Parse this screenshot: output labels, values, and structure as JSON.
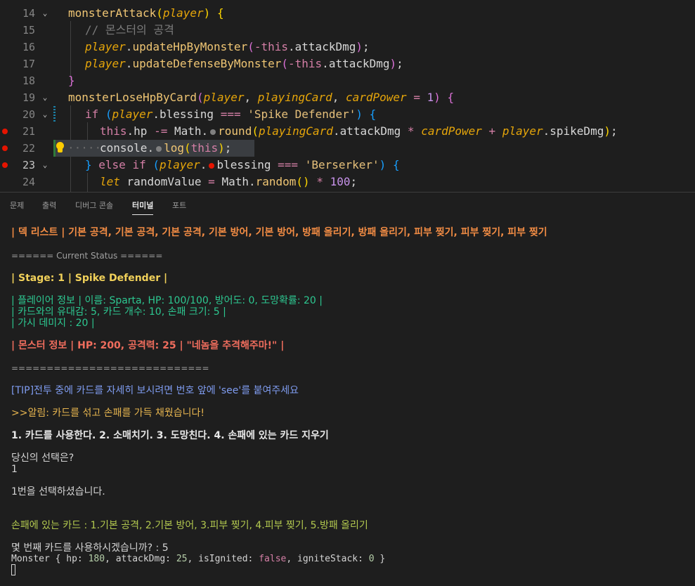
{
  "editor": {
    "lines": [
      {
        "num": "14",
        "tokens": [
          [
            "monsterAttack",
            "c-def"
          ],
          [
            "(",
            "b1c"
          ],
          [
            "player",
            "c-param"
          ],
          ")",
          "b1c"
        ],
        "fold": "⌄",
        "indent": 0
      },
      {
        "num": "15",
        "tokens": [
          [
            "// 몬스터의 공격",
            "c-cmt"
          ]
        ],
        "indent": 1
      },
      {
        "num": "16",
        "tokens": [
          [
            "player",
            "c-param"
          ],
          [
            ".",
            "op"
          ],
          [
            "updateHpByMonster",
            "c-def"
          ],
          [
            "(",
            "b2c"
          ],
          [
            "-",
            "c-key"
          ],
          [
            "this",
            "c-this"
          ],
          [
            ".attackDmg",
            "c-name"
          ],
          [
            ")",
            "b2c"
          ],
          [
            ";",
            "op"
          ]
        ],
        "indent": 1
      },
      {
        "num": "17",
        "tokens": [
          [
            "player",
            "c-param"
          ],
          [
            ".",
            "op"
          ],
          [
            "updateDefenseByMonster",
            "c-def"
          ],
          [
            "(",
            "b2c"
          ],
          [
            "-",
            "c-key"
          ],
          [
            "this",
            "c-this"
          ],
          [
            ".attackDmg",
            "c-name"
          ],
          [
            ")",
            "b2c"
          ],
          [
            ";",
            "op"
          ]
        ],
        "indent": 1
      },
      {
        "num": "18",
        "tokens": [
          [
            "}",
            "b1c"
          ]
        ],
        "indent": 0
      }
    ]
  },
  "code": {
    "l14": {
      "num": "14",
      "name": "monsterAttack",
      "param": "player"
    },
    "l15": {
      "num": "15",
      "comment": "// 몬스터의 공격"
    },
    "l16": {
      "num": "16",
      "obj": "player",
      "method": "updateHpByMonster",
      "this": "this",
      "prop": "attackDmg"
    },
    "l17": {
      "num": "17",
      "obj": "player",
      "method": "updateDefenseByMonster",
      "this": "this",
      "prop": "attackDmg"
    },
    "l18": {
      "num": "18"
    },
    "l19": {
      "num": "19",
      "name": "monsterLoseHpByCard",
      "p1": "player",
      "p2": "playingCard",
      "p3": "cardPower",
      "default": "1"
    },
    "l20": {
      "num": "20",
      "if": "if",
      "obj": "player",
      "prop": "blessing",
      "op": "===",
      "str": "'Spike Defender'"
    },
    "l21": {
      "num": "21",
      "this": "this",
      "prop": "hp",
      "op": "-=",
      "math": "Math",
      "fn": "round",
      "p1": "playingCard",
      "p2": "attackDmg",
      "p3": "cardPower",
      "p4": "player",
      "p5": "spikeDmg"
    },
    "l22": {
      "num": "22",
      "obj": "console",
      "fn": "log",
      "arg": "this"
    },
    "l23": {
      "num": "23",
      "else": "else",
      "if": "if",
      "obj": "player",
      "prop": "blessing",
      "op": "===",
      "str": "'Berserker'"
    },
    "l24": {
      "num": "24",
      "let": "let",
      "var": "randomValue",
      "math": "Math",
      "fn": "random",
      "num100": "100"
    }
  },
  "tabs": {
    "problems": "문제",
    "output": "출력",
    "debug": "디버그 콘솔",
    "terminal": "터미널",
    "ports": "포트"
  },
  "terminal": {
    "deck": "| 덱 리스트 | 기본 공격, 기본 공격, 기본 공격, 기본 방어, 기본 방어, 방패 올리기, 방패 올리기, 피부 찢기, 피부 찢기, 피부 찢기",
    "status_header": "====== Current Status ======",
    "stage": "| Stage: 1 | Spike Defender |",
    "player_info": "| 플레이어 정보 | 이름: Sparta, HP: 100/100, 방어도: 0, 도망확률: 20 |",
    "card_info": "| 카드와의 유대감: 5, 카드 개수: 10, 손패 크기: 5 |",
    "spike_dmg": "| 가시 데미지 : 20 |",
    "monster_info": "| 몬스터 정보 | HP: 200, 공격력: 25 | \"네놈을 추격해주마!\" |",
    "divider": "============================",
    "tip": "[TIP]전투 중에 카드를 자세히 보시려면 번호 앞에 'see'를 붙여주세요",
    "alert": ">>알림: 카드를 섞고 손패를 가득 채웠습니다!",
    "menu": "1. 카드를 사용한다. 2. 소매치기. 3. 도망친다. 4. 손패에 있는 카드 지우기",
    "prompt": "당신의 선택은?",
    "input1": "1",
    "selected": "1번을 선택하셨습니다.",
    "hand": "손패에 있는 카드 : 1.기본 공격, 2.기본 방어, 3.피부 찢기, 4.피부 찢기, 5.방패 올리기",
    "which_card": "몇 번째 카드를 사용하시겠습니까? : 5",
    "monster_log_prefix": "Monster { hp: ",
    "monster_log_hp": "180",
    "monster_log_mid1": ", attackDmg: ",
    "monster_log_atk": "25",
    "monster_log_mid2": ", isIgnited: ",
    "monster_log_ign": "false",
    "monster_log_mid3": ", igniteStack: ",
    "monster_log_stack": "0",
    "monster_log_suffix": " }"
  },
  "colors": {
    "background": "#1e1e1e",
    "breakpoint": "#e51400",
    "terminal_orange": "#f28c44",
    "terminal_green": "#2dc891",
    "terminal_red": "#ef6d5d",
    "terminal_blue": "#7f9cf0"
  }
}
